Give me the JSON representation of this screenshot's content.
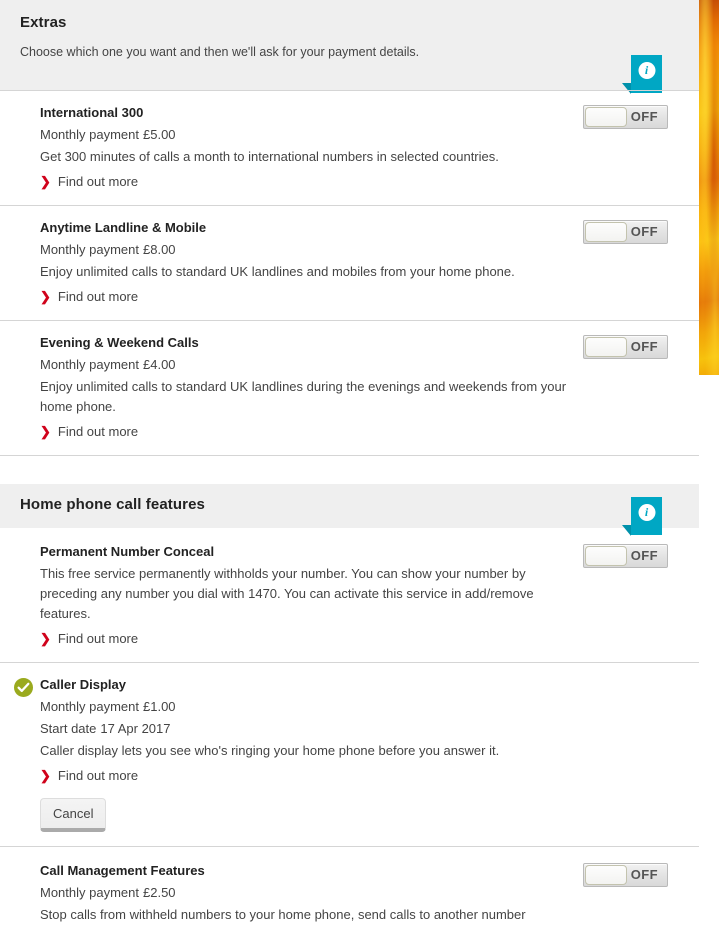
{
  "decor": {
    "edge_strip_name": "flame-image-strip"
  },
  "sections": [
    {
      "id": "extras",
      "title": "Extras",
      "subtitle": "Choose which one you want and then we'll ask for your payment details.",
      "info_icon": "info-icon",
      "items": [
        {
          "name": "International 300",
          "payment_label": "Monthly payment",
          "payment_value": "£5.00",
          "description": "Get 300 minutes of calls a month to international numbers in selected countries.",
          "link": "Find out more",
          "toggle_state": "OFF",
          "active": false
        },
        {
          "name": "Anytime Landline & Mobile",
          "payment_label": "Monthly payment",
          "payment_value": "£8.00",
          "description": "Enjoy unlimited calls to standard UK landlines and mobiles from your home phone.",
          "link": "Find out more",
          "toggle_state": "OFF",
          "active": false
        },
        {
          "name": "Evening & Weekend Calls",
          "payment_label": "Monthly payment",
          "payment_value": "£4.00",
          "description": "Enjoy unlimited calls to standard UK landlines during the evenings and weekends from your home phone.",
          "link": "Find out more",
          "toggle_state": "OFF",
          "active": false
        }
      ]
    },
    {
      "id": "home-phone-call-features",
      "title": "Home phone call features",
      "subtitle": "",
      "info_icon": "info-icon",
      "items": [
        {
          "name": "Permanent Number Conceal",
          "payment_label": "",
          "payment_value": "",
          "description": "This free service permanently withholds your number. You can show your number by preceding any number you dial with 1470. You can activate this service in add/remove features.",
          "link": "Find out more",
          "toggle_state": "OFF",
          "active": false
        },
        {
          "name": "Caller Display",
          "payment_label": "Monthly payment",
          "payment_value": "£1.00",
          "start_label": "Start date",
          "start_value": "17 Apr 2017",
          "description": "Caller display lets you see who's ringing your home phone before you answer it.",
          "link": "Find out more",
          "cancel_label": "Cancel",
          "active": true,
          "active_icon": "check-circle-icon"
        },
        {
          "name": "Call Management Features",
          "payment_label": "Monthly payment",
          "payment_value": "£2.50",
          "description": "Stop calls from withheld numbers to your home phone, send calls to another number",
          "toggle_state": "OFF",
          "active": false
        }
      ]
    }
  ],
  "colors": {
    "info_badge": "#00a7c4",
    "active_check": "#9aaa1e",
    "link_chevron": "#d0021b",
    "header_bg": "#efefef"
  }
}
